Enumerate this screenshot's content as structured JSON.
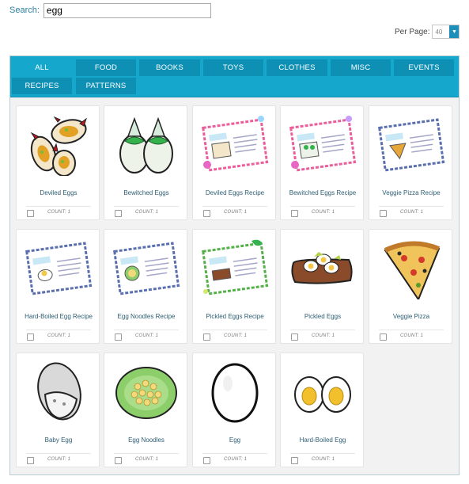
{
  "search": {
    "label": "Search:",
    "value": "egg"
  },
  "per_page": {
    "label": "Per Page:",
    "value": "40",
    "options_shown": [
      "40"
    ]
  },
  "tabs": [
    {
      "label": "ALL",
      "active": true
    },
    {
      "label": "FOOD"
    },
    {
      "label": "BOOKS"
    },
    {
      "label": "TOYS"
    },
    {
      "label": "CLOTHES"
    },
    {
      "label": "MISC"
    },
    {
      "label": "EVENTS"
    },
    {
      "label": "RECIPES"
    },
    {
      "label": "PATTERNS"
    }
  ],
  "items": [
    {
      "name": "Deviled Eggs",
      "count": "COUNT: 1",
      "icon": "deviled-eggs-icon"
    },
    {
      "name": "Bewitched Eggs",
      "count": "COUNT: 1",
      "icon": "bewitched-eggs-icon"
    },
    {
      "name": "Deviled Eggs Recipe",
      "count": "COUNT: 1",
      "icon": "recipe-card-icon"
    },
    {
      "name": "Bewitched Eggs Recipe",
      "count": "COUNT: 1",
      "icon": "recipe-card-icon"
    },
    {
      "name": "Veggie Pizza Recipe",
      "count": "COUNT: 1",
      "icon": "recipe-card-icon"
    },
    {
      "name": "Hard-Boiled Egg Recipe",
      "count": "COUNT: 1",
      "icon": "recipe-card-icon"
    },
    {
      "name": "Egg Noodles Recipe",
      "count": "COUNT: 1",
      "icon": "recipe-card-icon"
    },
    {
      "name": "Pickled Eggs Recipe",
      "count": "COUNT: 1",
      "icon": "recipe-card-icon"
    },
    {
      "name": "Pickled Eggs",
      "count": "COUNT: 1",
      "icon": "pickled-eggs-icon"
    },
    {
      "name": "Veggie Pizza",
      "count": "COUNT: 1",
      "icon": "pizza-slice-icon"
    },
    {
      "name": "Baby Egg",
      "count": "COUNT: 1",
      "icon": "baby-egg-icon"
    },
    {
      "name": "Egg Noodles",
      "count": "COUNT: 1",
      "icon": "egg-noodles-icon"
    },
    {
      "name": "Egg",
      "count": "COUNT: 1",
      "icon": "egg-icon"
    },
    {
      "name": "Hard-Boiled Egg",
      "count": "COUNT: 1",
      "icon": "hard-boiled-egg-icon"
    }
  ],
  "colors": {
    "accent": "#16a7cc",
    "tab_bg": "#0e8fb4",
    "item_name": "#2d5e73",
    "panel_bg": "#f2f2f2"
  }
}
